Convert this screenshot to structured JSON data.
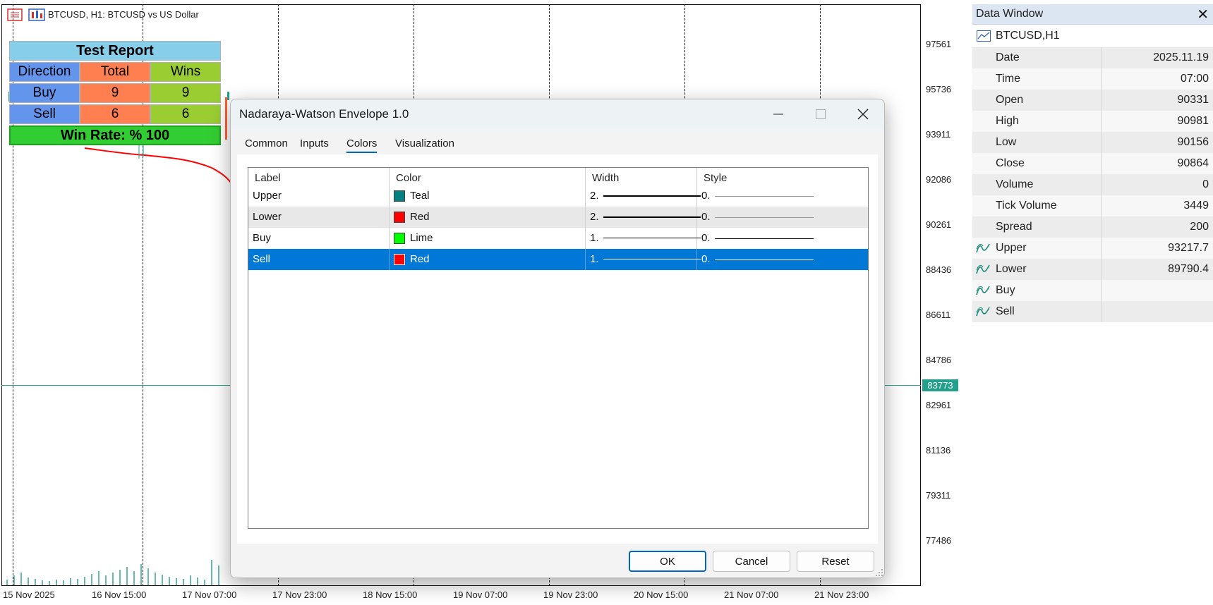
{
  "chart": {
    "title": "BTCUSD, H1:  BTCUSD vs US Dollar",
    "price_levels": [
      "97561",
      "95736",
      "93911",
      "92086",
      "90261",
      "88436",
      "86611",
      "84786",
      "82961",
      "81136",
      "79311",
      "77486"
    ],
    "last_price": "83773",
    "time_labels": [
      "15 Nov 2025",
      "16 Nov 15:00",
      "17 Nov 07:00",
      "17 Nov 23:00",
      "18 Nov 15:00",
      "19 Nov 07:00",
      "19 Nov 23:00",
      "20 Nov 15:00",
      "21 Nov 07:00",
      "21 Nov 23:00"
    ],
    "line_color": "#ff0000",
    "accent_color": "#23a08c"
  },
  "report": {
    "title": "Test Report",
    "headers": [
      "Direction",
      "Total",
      "Wins"
    ],
    "rows": [
      {
        "direction": "Buy",
        "total": "9",
        "wins": "9"
      },
      {
        "direction": "Sell",
        "total": "6",
        "wins": "6"
      }
    ],
    "win_rate": "Win Rate: %  100"
  },
  "dialog": {
    "title": "Nadaraya-Watson Envelope 1.0",
    "tabs": [
      "Common",
      "Inputs",
      "Colors",
      "Visualization"
    ],
    "active_tab": "Colors",
    "columns": [
      "Label",
      "Color",
      "Width",
      "Style"
    ],
    "rows": [
      {
        "label": "Upper",
        "color_name": "Teal",
        "color": "#008080",
        "width": "2.",
        "style": "0."
      },
      {
        "label": "Lower",
        "color_name": "Red",
        "color": "#ff0000",
        "width": "2.",
        "style": "0."
      },
      {
        "label": "Buy",
        "color_name": "Lime",
        "color": "#00ff00",
        "width": "1.",
        "style": "0."
      },
      {
        "label": "Sell",
        "color_name": "Red",
        "color": "#ff0000",
        "width": "1.",
        "style": "0."
      }
    ],
    "selected_row": "Sell",
    "buttons": {
      "ok": "OK",
      "cancel": "Cancel",
      "reset": "Reset"
    }
  },
  "data_window": {
    "title": "Data Window",
    "symbol": "BTCUSD,H1",
    "rows": [
      {
        "label": "Date",
        "value": "2025.11.19"
      },
      {
        "label": "Time",
        "value": "07:00"
      },
      {
        "label": "Open",
        "value": "90331"
      },
      {
        "label": "High",
        "value": "90981"
      },
      {
        "label": "Low",
        "value": "90156"
      },
      {
        "label": "Close",
        "value": "90864"
      },
      {
        "label": "Volume",
        "value": "0"
      },
      {
        "label": "Tick Volume",
        "value": "3449"
      },
      {
        "label": "Spread",
        "value": "200"
      },
      {
        "label": "Upper",
        "value": "93217.7",
        "icon": "indicator-icon"
      },
      {
        "label": "Lower",
        "value": "89790.4",
        "icon": "indicator-icon"
      },
      {
        "label": "Buy",
        "value": "",
        "icon": "indicator-icon"
      },
      {
        "label": "Sell",
        "value": "",
        "icon": "indicator-icon"
      }
    ]
  }
}
